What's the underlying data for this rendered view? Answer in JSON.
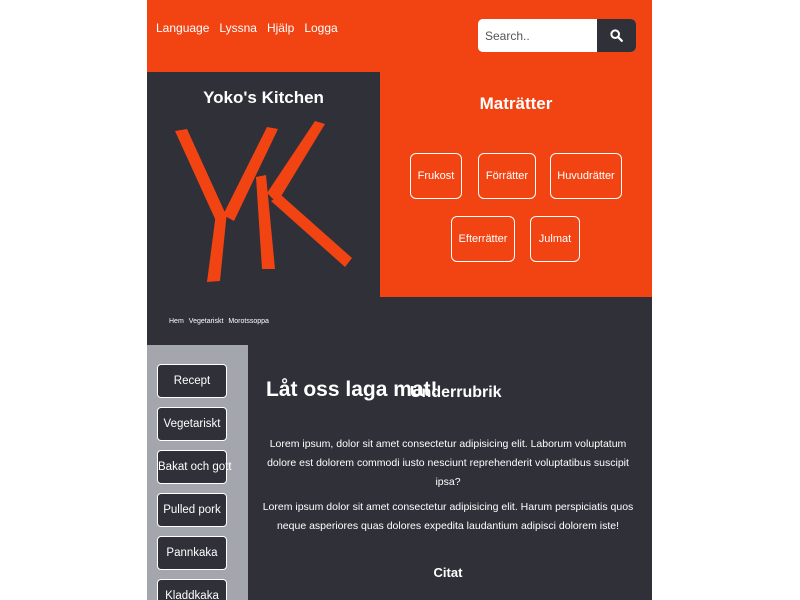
{
  "header": {
    "nav": [
      "Language",
      "Lyssna",
      "Hjälp",
      "Logga"
    ],
    "search_placeholder": "Search..",
    "search_icon": "magnifier-icon"
  },
  "logo": {
    "title": "Yoko's Kitchen",
    "mark": "YK",
    "color": "#f24413"
  },
  "dishes": {
    "title": "Maträtter",
    "items": [
      "Frukost",
      "Förrätter",
      "Huvudrätter",
      "Efterrätter",
      "Julmat"
    ]
  },
  "breadcrumb": [
    "Hem",
    "Vegetariskt",
    "Morotssoppa"
  ],
  "sidebar": {
    "items": [
      "Recept",
      "Vegetariskt",
      "Bakat och gott",
      "Pulled pork",
      "Pannkaka",
      "Kladdkaka"
    ]
  },
  "main": {
    "heading": "Låt oss laga mat!",
    "subheading": "Underrubrik",
    "paragraphs": [
      "Lorem ipsum, dolor sit amet consectetur adipisicing elit. Laborum voluptatum dolore est dolorem commodi iusto nesciunt reprehenderit voluptatibus suscipit ipsa?",
      "Lorem ipsum dolor sit amet consectetur adipisicing elit. Harum perspiciatis quos neque asperiores quas dolores expedita laudantium adipisci dolorem iste!"
    ],
    "quote_heading": "Citat"
  },
  "colors": {
    "accent": "#f24413",
    "dark": "#2f3038",
    "sidebar": "#a3a6ad"
  }
}
